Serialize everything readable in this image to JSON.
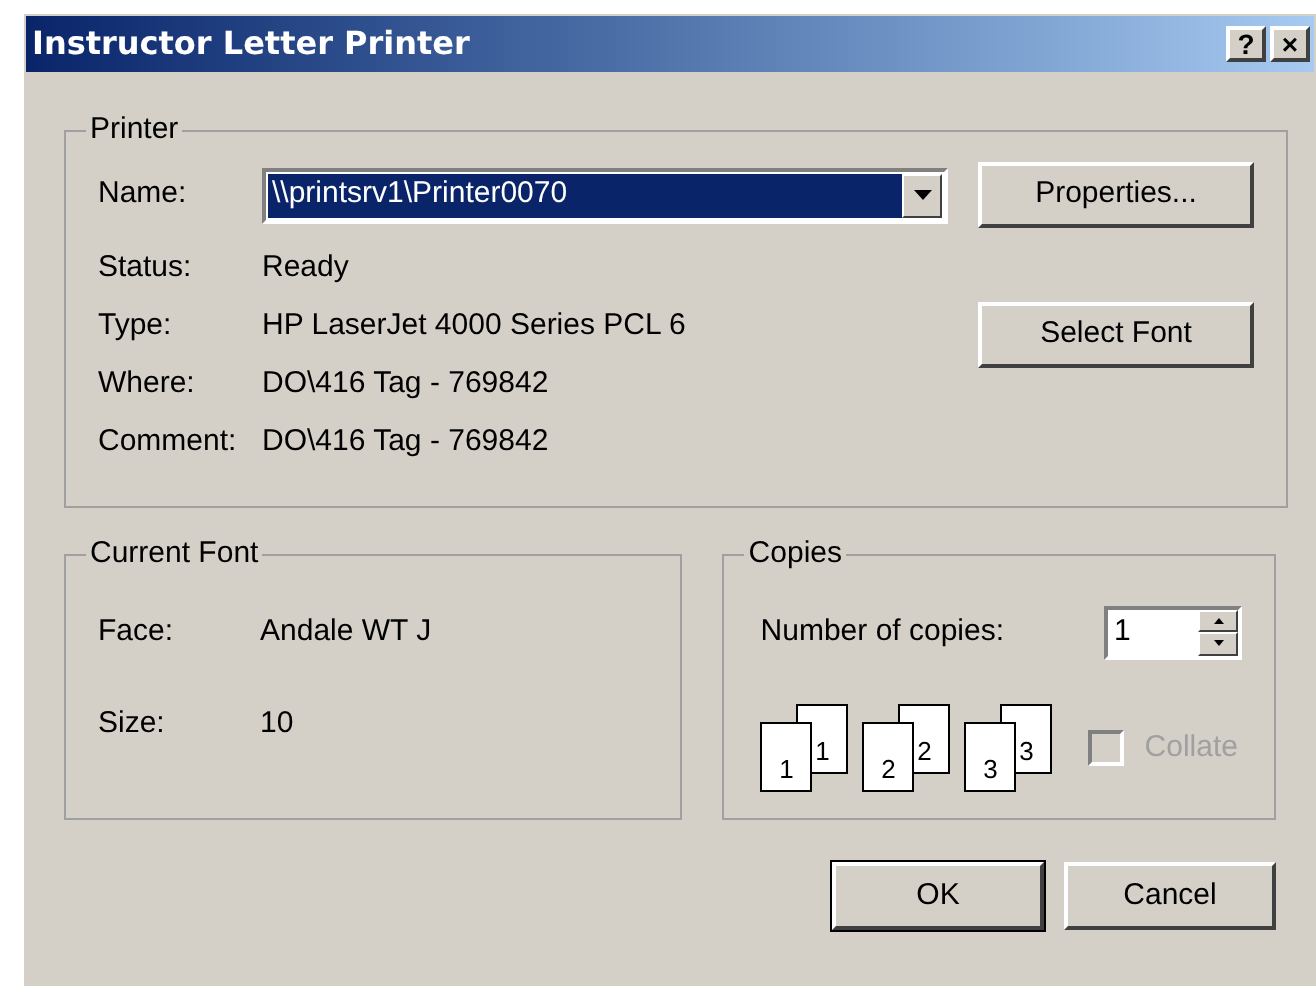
{
  "window": {
    "title": "Instructor Letter Printer",
    "title_buttons": [
      "?",
      "×"
    ]
  },
  "printer": {
    "label": "Printer",
    "name": {
      "label": "Name:",
      "value": "\\\\printsrv1\\Printer0070",
      "selected": true
    },
    "fields": [
      {
        "label": "Status:",
        "value": "Ready"
      },
      {
        "label": "Type:",
        "value": "HP LaserJet 4000 Series PCL 6"
      },
      {
        "label": "Where:",
        "value": "DO\\416 Tag - 769842"
      },
      {
        "label": "Comment:",
        "value": "DO\\416 Tag - 769842"
      }
    ],
    "buttons": [
      "Properties...",
      "Select Font"
    ]
  },
  "current_font": {
    "label": "Current Font",
    "fields": [
      {
        "label": "Face:",
        "value": "Andale WT J"
      },
      {
        "label": "Size:",
        "value": "10"
      }
    ]
  },
  "copies": {
    "label": "Copies",
    "number_label": "Number of copies:",
    "number_value": "1",
    "collate_pages": [
      [
        "1",
        "1"
      ],
      [
        "2",
        "2"
      ],
      [
        "3",
        "3"
      ]
    ],
    "collate": {
      "label": "Collate",
      "checked": false,
      "disabled": true
    }
  },
  "buttons": [
    {
      "label": "OK",
      "default": true
    },
    {
      "label": "Cancel",
      "default": false
    }
  ]
}
